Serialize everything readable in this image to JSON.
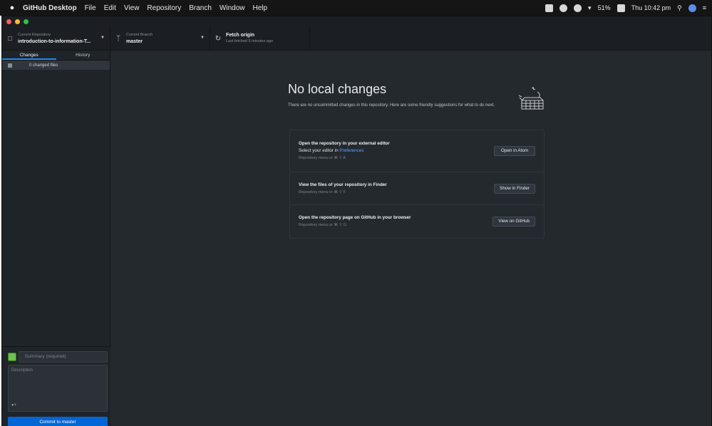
{
  "menubar": {
    "apple_icon": "apple-icon",
    "items": [
      "GitHub Desktop",
      "File",
      "Edit",
      "View",
      "Repository",
      "Branch",
      "Window",
      "Help"
    ],
    "status": {
      "battery": "51%",
      "clock": "Thu 10:42 pm"
    }
  },
  "toolbar": {
    "repo_label": "Current Repository",
    "repo_value": "introduction-to-information-T...",
    "branch_label": "Current Branch",
    "branch_value": "master",
    "fetch_title": "Fetch origin",
    "fetch_sub": "Last fetched 5 minutes ago"
  },
  "sidebar": {
    "tabs": [
      "Changes",
      "History"
    ],
    "changed_files": "0 changed files",
    "summary_placeholder": "Summary (required)",
    "description_placeholder": "Description",
    "commit_button": "Commit to master"
  },
  "main": {
    "heading": "No local changes",
    "lead": "There are no uncommitted changes in this repository. Here are some friendly suggestions for what to do next.",
    "actions": [
      {
        "title": "Open the repository in your external editor",
        "desc_prefix": "Select your editor in ",
        "desc_link": "Preferences",
        "shortcut": "Repository menu or ⌘ ⇧ A",
        "button": "Open in Atom"
      },
      {
        "title": "View the files of your repository in Finder",
        "shortcut": "Repository menu or ⌘ ⇧ F",
        "button": "Show in Finder"
      },
      {
        "title": "Open the repository page on GitHub in your browser",
        "shortcut": "Repository menu or ⌘ ⇧ G",
        "button": "View on GitHub"
      }
    ]
  },
  "colors": {
    "accent": "#0366d6",
    "link": "#58a6ff",
    "background": "#24292e"
  }
}
